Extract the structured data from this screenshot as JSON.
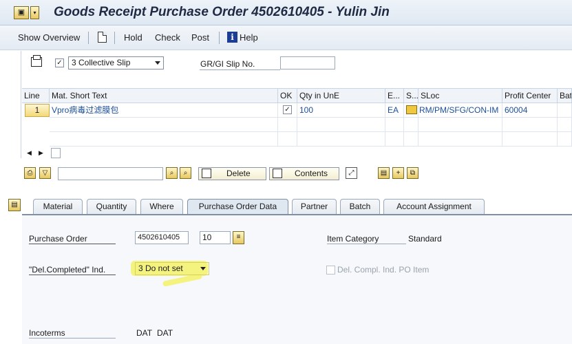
{
  "window": {
    "title": "Goods Receipt Purchase Order 4502610405 - Yulin Jin"
  },
  "toolbar": {
    "show_overview": "Show Overview",
    "hold": "Hold",
    "check": "Check",
    "post": "Post",
    "help": "Help"
  },
  "header": {
    "slip_checkbox": "✓",
    "slip_select": "3 Collective Slip",
    "gr_slip_label": "GR/GI Slip No.",
    "gr_slip_value": ""
  },
  "table": {
    "columns": [
      "Line",
      "Mat. Short Text",
      "OK",
      "Qty in UnE",
      "E...",
      "S...",
      "SLoc",
      "Profit Center",
      "Batch"
    ],
    "rows": [
      {
        "line": "1",
        "mat_short_text": "Vpro病毒过滤膜包",
        "ok": "✓",
        "qty": "100",
        "unit": "EA",
        "sloc": "RM/PM/SFG/CON-IM",
        "profit_center": "60004",
        "batch": ""
      }
    ]
  },
  "item_toolbar": {
    "delete": "Delete",
    "contents": "Contents"
  },
  "tabs": [
    {
      "label": "Material"
    },
    {
      "label": "Quantity"
    },
    {
      "label": "Where"
    },
    {
      "label": "Purchase Order Data"
    },
    {
      "label": "Partner"
    },
    {
      "label": "Batch"
    },
    {
      "label": "Account Assignment"
    }
  ],
  "po_data": {
    "purchase_order_label": "Purchase Order",
    "purchase_order_value": "4502610405",
    "po_item_value": "10",
    "item_category_label": "Item Category",
    "item_category_value": "Standard",
    "del_completed_label": "\"Del.Completed\" Ind.",
    "del_completed_value": "3 Do not set",
    "del_compl_po_label": "Del. Compl. Ind. PO Item",
    "incoterms_label": "Incoterms",
    "incoterms_value_1": "DAT",
    "incoterms_value_2": "DAT"
  },
  "colors": {
    "highlight": "#f4f26a",
    "link_text": "#1c4f9a",
    "title_text": "#1f2a44"
  }
}
